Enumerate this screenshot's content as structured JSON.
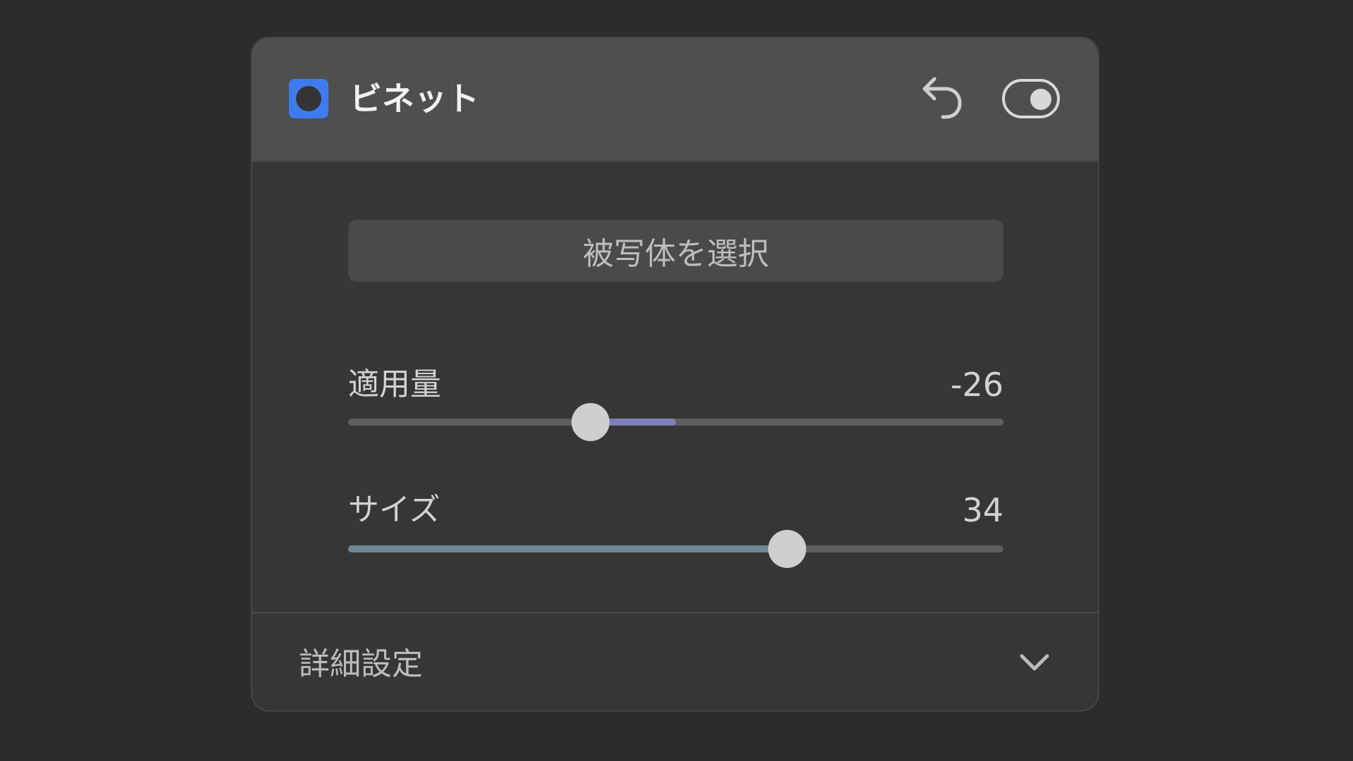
{
  "panel": {
    "title": "ビネット",
    "select_button_label": "被写体を選択",
    "undo_icon": "undo-icon",
    "toggle_icon": "toggle-icon",
    "toggle_on": true,
    "accent_color": "#3f7bf0"
  },
  "sliders": [
    {
      "label": "適用量",
      "value": "-26",
      "min": -100,
      "max": 100,
      "fill_color": "#7d7fb8"
    },
    {
      "label": "サイズ",
      "value": "34",
      "min": -100,
      "max": 100,
      "fill_color": "#6f8796"
    }
  ],
  "footer": {
    "label": "詳細設定",
    "chevron_icon": "chevron-down-icon"
  }
}
